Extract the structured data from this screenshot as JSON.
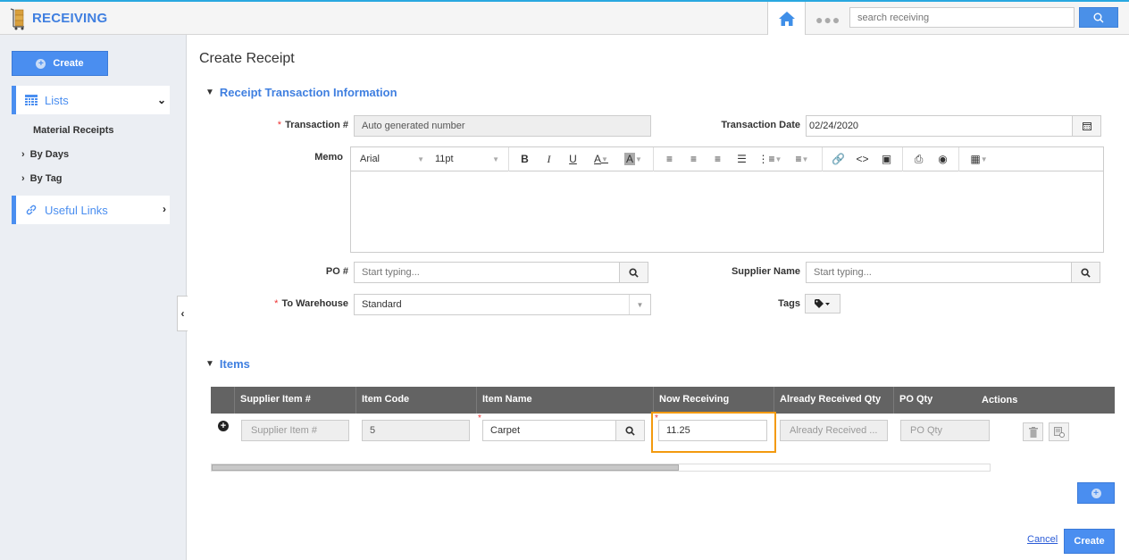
{
  "app": {
    "title": "RECEIVING",
    "brand_color": "#3f7fe0",
    "accent_color": "#4a8ef0"
  },
  "header": {
    "search_placeholder": "search receiving",
    "more_label": "●●●"
  },
  "sidebar": {
    "create_label": "Create",
    "lists_label": "Lists",
    "links": [
      {
        "label": "Material Receipts",
        "has_chevron": false
      },
      {
        "label": "By Days",
        "has_chevron": true
      },
      {
        "label": "By Tag",
        "has_chevron": true
      }
    ],
    "useful_links_label": "Useful Links"
  },
  "main": {
    "page_title": "Create Receipt",
    "section_transaction": "Receipt Transaction Information",
    "fields": {
      "transaction_label": "Transaction #",
      "transaction_value": "Auto generated number",
      "transaction_date_label": "Transaction Date",
      "transaction_date_value": "02/24/2020",
      "memo_label": "Memo",
      "po_label": "PO #",
      "po_placeholder": "Start typing...",
      "supplier_label": "Supplier Name",
      "supplier_placeholder": "Start typing...",
      "warehouse_label": "To Warehouse",
      "warehouse_value": "Standard",
      "tags_label": "Tags"
    },
    "editor": {
      "font": "Arial",
      "size": "11pt"
    },
    "section_items": "Items",
    "items_table": {
      "columns": [
        "Supplier Item #",
        "Item Code",
        "Item Name",
        "Now Receiving",
        "Already Received Qty",
        "PO Qty",
        "Actions"
      ],
      "rows": [
        {
          "supplier_item_placeholder": "Supplier Item #",
          "item_code": "5",
          "item_name": "Carpet",
          "now_receiving": "11.25",
          "already_received_placeholder": "Already Received ...",
          "po_qty_placeholder": "PO Qty"
        }
      ],
      "scroll_position_fraction": 0.6
    },
    "cancel_label": "Cancel",
    "create_label": "Create"
  }
}
